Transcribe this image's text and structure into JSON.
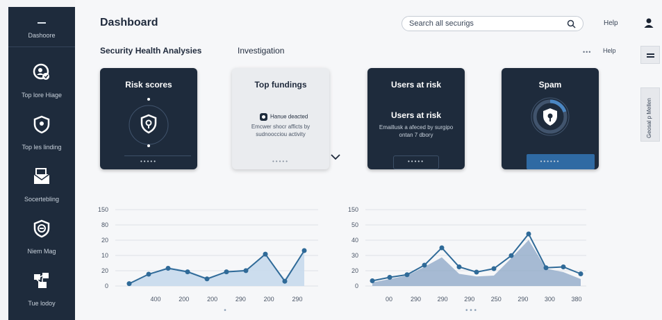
{
  "sidebar": {
    "top_label": "Dashoore",
    "items": [
      {
        "label": "Top lore Hiage",
        "icon": "user-shield-icon"
      },
      {
        "label": "Top les linding",
        "icon": "shield-icon"
      },
      {
        "label": "Socertebling",
        "icon": "envelope-icon"
      },
      {
        "label": "Niem Mag",
        "icon": "shield-badge-icon"
      },
      {
        "label": "Tue lodoy",
        "icon": "network-icon"
      }
    ]
  },
  "header": {
    "title": "Dashboard",
    "search_placeholder": "Search all securigs",
    "help": "Help"
  },
  "subheader": {
    "title": "Security Health Analysies",
    "tab": "Investigation",
    "more": "•••",
    "help": "Help"
  },
  "side_panel": {
    "label": "Geosal p Mellen"
  },
  "cards": [
    {
      "title": "Risk scores",
      "dots": "•••••"
    },
    {
      "title": "Top fundings",
      "alert": "Hanue deacted",
      "desc": "Emcwer shocr afficts by sudnoocciou activity",
      "dots": "•••••"
    },
    {
      "title": "Users at risk",
      "headline": "Users at risk",
      "desc": "Emaillusk a afeced by surgipo ontan 7 dbory",
      "dots": "•••••"
    },
    {
      "title": "Spam",
      "dots": "••••••"
    }
  ],
  "colors": {
    "sidebar": "#1e2b3c",
    "accent": "#2f6aa3",
    "area": "#c8d9ec"
  },
  "chart_data": [
    {
      "type": "line",
      "y_ticks": [
        "150",
        "80",
        "20",
        "10",
        "20",
        "0"
      ],
      "x_ticks": [
        "400",
        "200",
        "200",
        "290",
        "200",
        "290"
      ],
      "values": [
        0.1,
        0.5,
        0.75,
        0.6,
        0.3,
        0.6,
        0.65,
        1.35,
        0.2,
        1.5
      ],
      "area": [
        0.1,
        0.5,
        0.8,
        0.65,
        0.35,
        0.62,
        0.7,
        1.3,
        0.3,
        1.5
      ],
      "pagination": "•"
    },
    {
      "type": "line",
      "y_ticks": [
        "150",
        "50",
        "40",
        "30",
        "20",
        "0"
      ],
      "x_ticks": [
        "00",
        "290",
        "290",
        "290",
        "250",
        "290",
        "300",
        "380"
      ],
      "values": [
        0.3,
        0.5,
        0.65,
        1.2,
        2.2,
        1.1,
        0.8,
        1.0,
        1.75,
        3.0,
        1.05,
        1.1,
        0.7
      ],
      "area": [
        0.2,
        0.4,
        0.6,
        1.1,
        1.65,
        0.7,
        0.55,
        0.6,
        1.6,
        2.65,
        1.0,
        0.8,
        0.4
      ],
      "pagination": "• • •"
    }
  ]
}
